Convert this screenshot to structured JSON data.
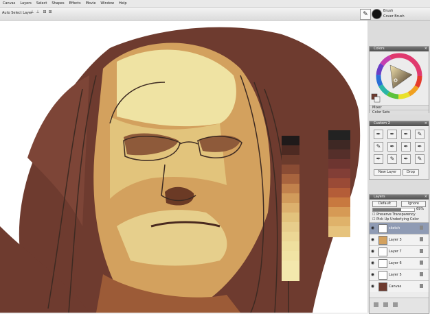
{
  "menubar": {
    "items": [
      "Canvas",
      "Layers",
      "Select",
      "Shapes",
      "Effects",
      "Movie",
      "Window",
      "Help"
    ]
  },
  "toolbar": {
    "auto_select_label": "Auto Select Layer",
    "brush_category": "Brush",
    "brush_variant": "Cover Brush"
  },
  "colors_panel": {
    "title": "Colors",
    "mixer_label": "Mixer",
    "color_sets_label": "Color Sets"
  },
  "custom_panel": {
    "title": "Custom 2",
    "new_layer_label": "New Layer",
    "drop_label": "Drop"
  },
  "layers_panel": {
    "title": "Layers",
    "composite_method": "Default",
    "ignore_label": "Ignore",
    "opacity": "69%",
    "preserve_transparency_label": "Preserve Transparency",
    "pick_up_color_label": "Pick Up Underlying Color",
    "layers": [
      "sketch",
      "Layer 3",
      "Layer 7",
      "Layer 6",
      "Layer 5",
      "Canvas"
    ]
  },
  "colors": {
    "accent_brown": "#6e3b2f",
    "skin_light": "#efe3a3",
    "skin_mid": "#c98b4e"
  },
  "icons": [
    "brush-selector-icon",
    "color-wheel-icon",
    "close-icon",
    "eye-icon",
    "lock-icon"
  ]
}
